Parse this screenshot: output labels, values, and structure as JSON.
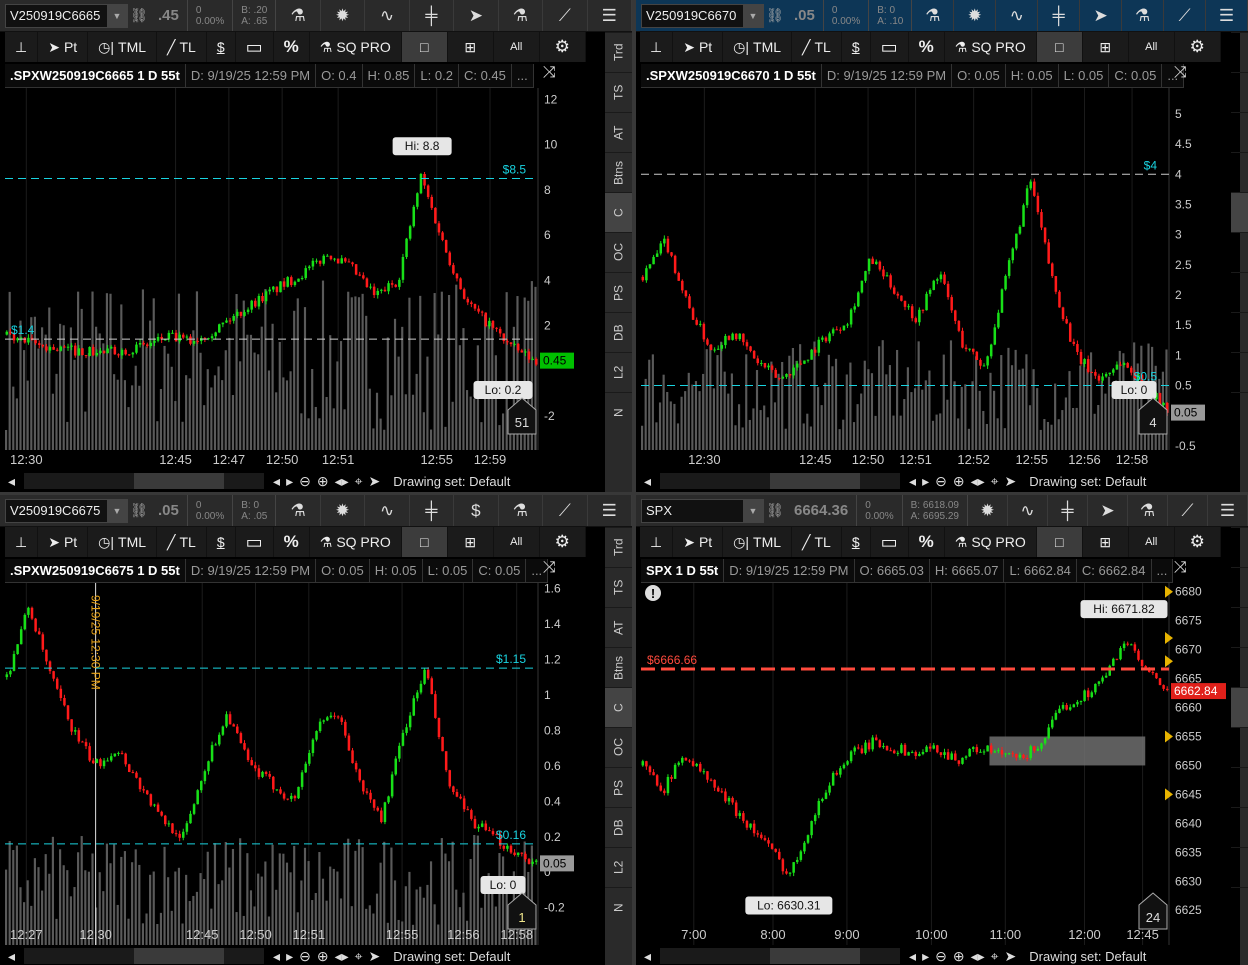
{
  "toolbar": {
    "pin": "⊥",
    "pt": "Pt",
    "tml": "TML",
    "tl": "TL",
    "price": "$",
    "rect": "▭",
    "pct": "%",
    "sq": "SQ PRO",
    "single": "□",
    "grid": "⊞",
    "all": "All",
    "gear": "⚙"
  },
  "side_tabs": [
    "Trd",
    "TS",
    "AT",
    "Btns",
    "C",
    "OC",
    "PS",
    "DB",
    "L2",
    "N"
  ],
  "drawing_set": "Drawing set: Default",
  "icons": {
    "flask": "⚗",
    "gear": "✹",
    "wave": "∿",
    "candles": "╪",
    "cursor": "➤",
    "dollar": "$",
    "drawing": "⟋",
    "menu": "☰",
    "link": "⛓",
    "swap": "⤨"
  },
  "panels": [
    {
      "symbol": "V250919C6665",
      "last": ".45",
      "change": "0",
      "change_pct": "0.00%",
      "bid": "B: .20",
      "ask": "A: .65",
      "quote_icons": [
        "flask",
        "gear",
        "wave",
        "candles",
        "cursor",
        "flask",
        "drawing",
        "menu"
      ],
      "title": ".SPXW250919C6665 1 D 55t",
      "date": "D: 9/19/25 12:59 PM",
      "open": "O: 0.4",
      "high": "H: 0.85",
      "low": "L: 0.2",
      "close": "C: 0.45",
      "more": "...",
      "y_range": [
        -3.5,
        12.5
      ],
      "y_ticks": [
        "12",
        "10",
        "8",
        "6",
        "4",
        "2",
        "-2"
      ],
      "path": [
        1.6,
        1.2,
        1.0,
        0.9,
        0.8,
        0.9,
        1.1,
        1.5,
        1.3,
        1.8,
        2.5,
        3.2,
        3.8,
        4.4,
        5.2,
        4.5,
        3.3,
        4.0,
        8.6,
        5.5,
        3.0,
        2.0,
        1.0,
        0.4
      ],
      "hlines": [
        {
          "price": 8.5,
          "label": "$8.5",
          "color": "#19d3e0",
          "label_color": "#19d3e0"
        },
        {
          "price": 1.4,
          "label": "$1.4",
          "color": "#cccccc",
          "label_color": "#19d3e0",
          "label_side": "left"
        }
      ],
      "hi_label": "Hi: 8.8",
      "lo_label": "Lo: 0.2",
      "last_badge": "0.45",
      "last_value": 0.45,
      "badge_color": "#00c000",
      "badge_text": "#000",
      "count": "51",
      "volume": true,
      "times": [
        "12:30",
        "12:45",
        "12:47",
        "12:50",
        "12:51",
        "12:55",
        "12:59"
      ]
    },
    {
      "symbol": "V250919C6670",
      "last": ".05",
      "change": "0",
      "change_pct": "0.00%",
      "bid": "B: 0",
      "ask": "A: .10",
      "quote_icons": [
        "flask",
        "gear",
        "wave",
        "candles",
        "cursor",
        "flask",
        "drawing",
        "menu"
      ],
      "title": ".SPXW250919C6670 1 D 55t",
      "date": "D: 9/19/25 12:59 PM",
      "open": "O: 0.05",
      "high": "H: 0.05",
      "low": "L: 0.05",
      "close": "C: 0.05",
      "more": "...",
      "y_range": [
        -0.57,
        5.43
      ],
      "y_ticks": [
        "5",
        "4.5",
        "4",
        "3.5",
        "3",
        "2.5",
        "2",
        "1.5",
        "1",
        "0.5",
        "-0.5"
      ],
      "path": [
        2.3,
        2.9,
        1.8,
        1.1,
        1.4,
        0.9,
        0.6,
        0.9,
        1.3,
        1.6,
        2.6,
        2.1,
        1.6,
        2.4,
        1.2,
        0.8,
        2.4,
        3.9,
        2.2,
        1.0,
        0.6,
        0.9,
        0.5,
        0.1
      ],
      "hlines": [
        {
          "price": 4,
          "label": "$4",
          "color": "#cccccc",
          "label_color": "#19d3e0"
        },
        {
          "price": 0.5,
          "label": "$0.5",
          "color": "#19d3e0",
          "label_color": "#19d3e0"
        }
      ],
      "hi_label": null,
      "lo_label": "Lo: 0",
      "last_badge": "0.05",
      "last_value": 0.05,
      "badge_color": "#9a9a9a",
      "badge_text": "#000",
      "count": "4",
      "volume": true,
      "times": [
        "12:30",
        "12:45",
        "12:50",
        "12:51",
        "12:52",
        "12:55",
        "12:56",
        "12:58"
      ]
    },
    {
      "symbol": "V250919C6675",
      "last": ".05",
      "change": "0",
      "change_pct": "0.00%",
      "bid": "B: 0",
      "ask": "A: .05",
      "quote_icons": [
        "flask",
        "gear",
        "wave",
        "candles",
        "dollar",
        "flask",
        "drawing",
        "menu"
      ],
      "title": ".SPXW250919C6675 1 D 55t",
      "date": "D: 9/19/25 12:59 PM",
      "open": "O: 0.05",
      "high": "H: 0.05",
      "low": "L: 0.05",
      "close": "C: 0.05",
      "more": "...",
      "y_range": [
        -0.41,
        1.63
      ],
      "y_ticks": [
        "1.6",
        "1.4",
        "1.2",
        "1",
        "0.8",
        "0.6",
        "0.4",
        "0.2",
        "0",
        "-0.2"
      ],
      "path": [
        1.1,
        1.5,
        1.1,
        0.8,
        0.6,
        0.7,
        0.5,
        0.3,
        0.2,
        0.6,
        0.9,
        0.6,
        0.5,
        0.4,
        0.8,
        0.9,
        0.5,
        0.3,
        0.8,
        1.15,
        0.5,
        0.3,
        0.2,
        0.12,
        0.05
      ],
      "hlines": [
        {
          "price": 1.15,
          "label": "$1.15",
          "color": "#19d3e0",
          "label_color": "#19d3e0"
        },
        {
          "price": 0.16,
          "label": "$0.16",
          "color": "#19d3e0",
          "label_color": "#19d3e0"
        }
      ],
      "hi_label": null,
      "lo_label": "Lo: 0",
      "last_badge": "0.05",
      "last_value": 0.05,
      "badge_color": "#9a9a9a",
      "badge_text": "#000",
      "count": "1",
      "volume": true,
      "marker_label": "9/19/25 12:30 PM",
      "times": [
        "12:27",
        "12:30",
        "12:45",
        "12:50",
        "12:51",
        "12:55",
        "12:56",
        "12:58"
      ]
    },
    {
      "symbol": "SPX",
      "last": "6664.36",
      "change": "0",
      "change_pct": "0.00%",
      "bid": "B: 6618.09",
      "ask": "A: 6695.29",
      "quote_icons": [
        "gear",
        "wave",
        "candles",
        "cursor",
        "flask",
        "drawing",
        "menu"
      ],
      "title": "SPX 1 D 55t",
      "date": "D: 9/19/25 12:59 PM",
      "open": "O: 6665.03",
      "high": "H: 6665.07",
      "low": "L: 6662.84",
      "close": "C: 6662.84",
      "more": "...",
      "y_range": [
        6619,
        6681.5
      ],
      "y_ticks": [
        "6680",
        "6675",
        "6670",
        "6665",
        "6660",
        "6655",
        "6650",
        "6645",
        "6640",
        "6635",
        "6630",
        "6625"
      ],
      "path": [
        6650,
        6646,
        6652,
        6648,
        6644,
        6640,
        6636,
        6631,
        6640,
        6648,
        6652,
        6654,
        6653,
        6652,
        6653,
        6651,
        6653,
        6652,
        6651,
        6654,
        6660,
        6662,
        6665,
        6671.8,
        6666,
        6663
      ],
      "hlines": [
        {
          "price": 6666.66,
          "label": "$6666.66",
          "color": "#ff4a3d",
          "label_color": "#ff4a3d",
          "thick": true,
          "label_side": "left"
        }
      ],
      "hi_label": "Hi: 6671.82",
      "lo_label": "Lo: 6630.31",
      "last_badge": "6662.84",
      "last_value": 6662.84,
      "badge_color": "#e0201a",
      "badge_text": "#fff",
      "count": "24",
      "volume": false,
      "zone": {
        "from": 6650,
        "to": 6655
      },
      "alert": "!",
      "times": [
        "7:00",
        "8:00",
        "9:00",
        "10:00",
        "11:00",
        "12:00",
        "12:45"
      ]
    }
  ]
}
